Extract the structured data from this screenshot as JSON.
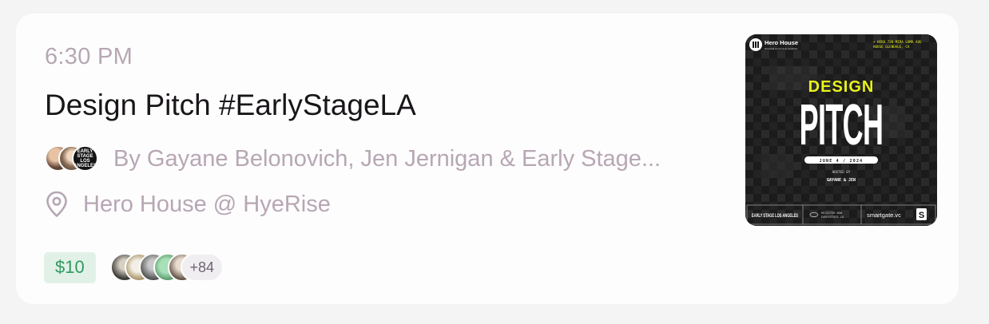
{
  "event": {
    "time": "6:30 PM",
    "title": "Design Pitch #EarlyStageLA",
    "hosts_text": "By Gayane Belonovich, Jen Jernigan & Early Stage...",
    "host_avatar_text": "EARLY STAGE LOS ANGELES",
    "location": "Hero House @ HyeRise",
    "price": "$10",
    "attendee_more": "+84"
  },
  "cover": {
    "brand": "Hero House",
    "brand_sub": "Essential Community Incubator",
    "addr_line1": "× HERO    720 MIRA LOMA AVE",
    "addr_line2": "HOUSE    GLENDALE, CA",
    "title_top": "DESIGN",
    "title_main": "PITCH",
    "date": "JUNE 4 / 2024",
    "hosted_label": "HOSTED BY",
    "hosted_names": "GAYANE & JEN",
    "footer_left": "EARLY STAGE LOS ANGELES",
    "footer_mid1": "REGISTER NOW",
    "footer_mid2": "EARLYSTAGE.LA",
    "footer_right": "smartgate.vc",
    "footer_badge": "S"
  },
  "colors": {
    "muted_text": "#b7a7b4",
    "title_text": "#19161a",
    "price_bg": "#e2f1e8",
    "price_text": "#2f9a5e",
    "cover_accent": "#e8f21a"
  }
}
